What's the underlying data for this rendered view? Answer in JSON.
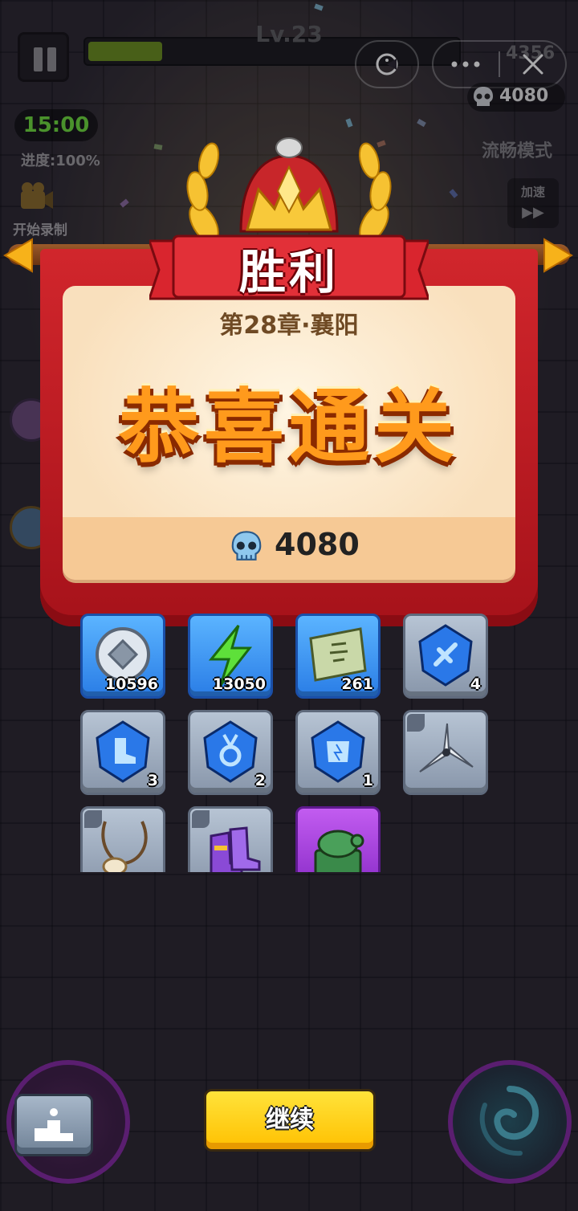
{
  "hud": {
    "level": "Lv.23",
    "xp_fraction": 0.2,
    "coins": "4356",
    "kills": "4080",
    "timer": "15:00",
    "progress": "进度:100%",
    "record_label": "开始录制",
    "smooth_mode": "流畅模式",
    "speed_label": "加速",
    "speed_arrows": "▶▶"
  },
  "victory": {
    "banner": "胜利",
    "chapter": "第28章·襄阳",
    "congrats": "恭喜通关",
    "reward_value": "4080"
  },
  "rewards": [
    {
      "name": "coin",
      "count": "10596",
      "rarity": "blue",
      "icon": "silver-coin-icon"
    },
    {
      "name": "energy",
      "count": "13050",
      "rarity": "blue",
      "icon": "lightning-icon"
    },
    {
      "name": "scroll",
      "count": "261",
      "rarity": "blue",
      "icon": "scroll-icon"
    },
    {
      "name": "weapon-gem",
      "count": "4",
      "rarity": "gray",
      "icon": "sword-gem-icon"
    },
    {
      "name": "boots-gem",
      "count": "3",
      "rarity": "gray",
      "icon": "boot-gem-icon"
    },
    {
      "name": "medal-gem",
      "count": "2",
      "rarity": "gray",
      "icon": "medal-gem-icon"
    },
    {
      "name": "armor-gem",
      "count": "1",
      "rarity": "gray",
      "icon": "armor-gem-icon"
    },
    {
      "name": "shuriken",
      "count": "",
      "rarity": "gray",
      "icon": "shuriken-icon"
    },
    {
      "name": "necklace",
      "count": "",
      "rarity": "gray",
      "icon": "necklace-icon"
    },
    {
      "name": "boots",
      "count": "",
      "rarity": "gray",
      "icon": "purple-boots-icon"
    },
    {
      "name": "jade-seal",
      "count": "",
      "rarity": "purple",
      "icon": "jade-turtle-icon"
    }
  ],
  "footer": {
    "continue_label": "继续"
  },
  "colors": {
    "banner_red": "#d1262c",
    "congrats_orange": "#ff9a1c",
    "button_yellow": "#ffc000",
    "rarity_blue": "#2a7de6",
    "rarity_gray": "#8896aa",
    "rarity_purple": "#8a2cc8"
  }
}
